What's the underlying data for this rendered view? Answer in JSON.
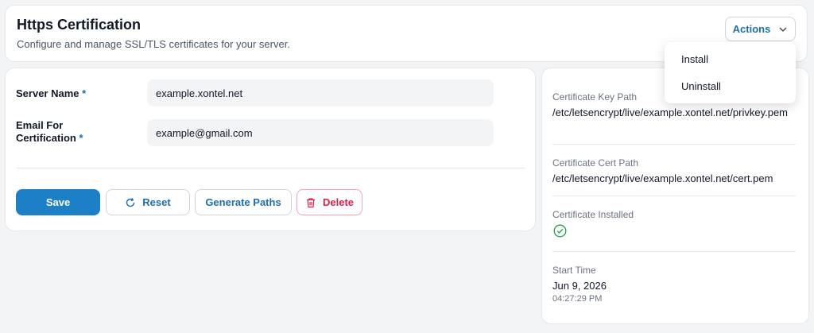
{
  "header": {
    "title": "Https Certification",
    "subtitle": "Configure and manage SSL/TLS certificates for your server.",
    "actions_label": "Actions"
  },
  "actions_menu": {
    "items": [
      {
        "label": "Install"
      },
      {
        "label": "Uninstall"
      }
    ]
  },
  "form": {
    "server_name": {
      "label": "Server Name",
      "required_mark": "*",
      "value": "example.xontel.net"
    },
    "email": {
      "label_line1": "Email For",
      "label_line2": "Certification",
      "required_mark": "*",
      "value": "example@gmail.com"
    },
    "buttons": {
      "save": "Save",
      "reset": "Reset",
      "generate_paths": "Generate Paths",
      "delete": "Delete"
    }
  },
  "info": {
    "key_path": {
      "label": "Certificate Key Path",
      "value": "/etc/letsencrypt/live/example.xontel.net/privkey.pem"
    },
    "cert_path": {
      "label": "Certificate Cert Path",
      "value": "/etc/letsencrypt/live/example.xontel.net/cert.pem"
    },
    "installed": {
      "label": "Certificate Installed",
      "icon": "check-circle-icon",
      "color": "#16a34a"
    },
    "start_time": {
      "label": "Start Time",
      "date": "Jun 9, 2026",
      "time": "04:27:29 PM"
    }
  },
  "colors": {
    "primary": "#1d7fc6",
    "accent_text": "#1d6fb0",
    "danger": "#e11d48"
  }
}
